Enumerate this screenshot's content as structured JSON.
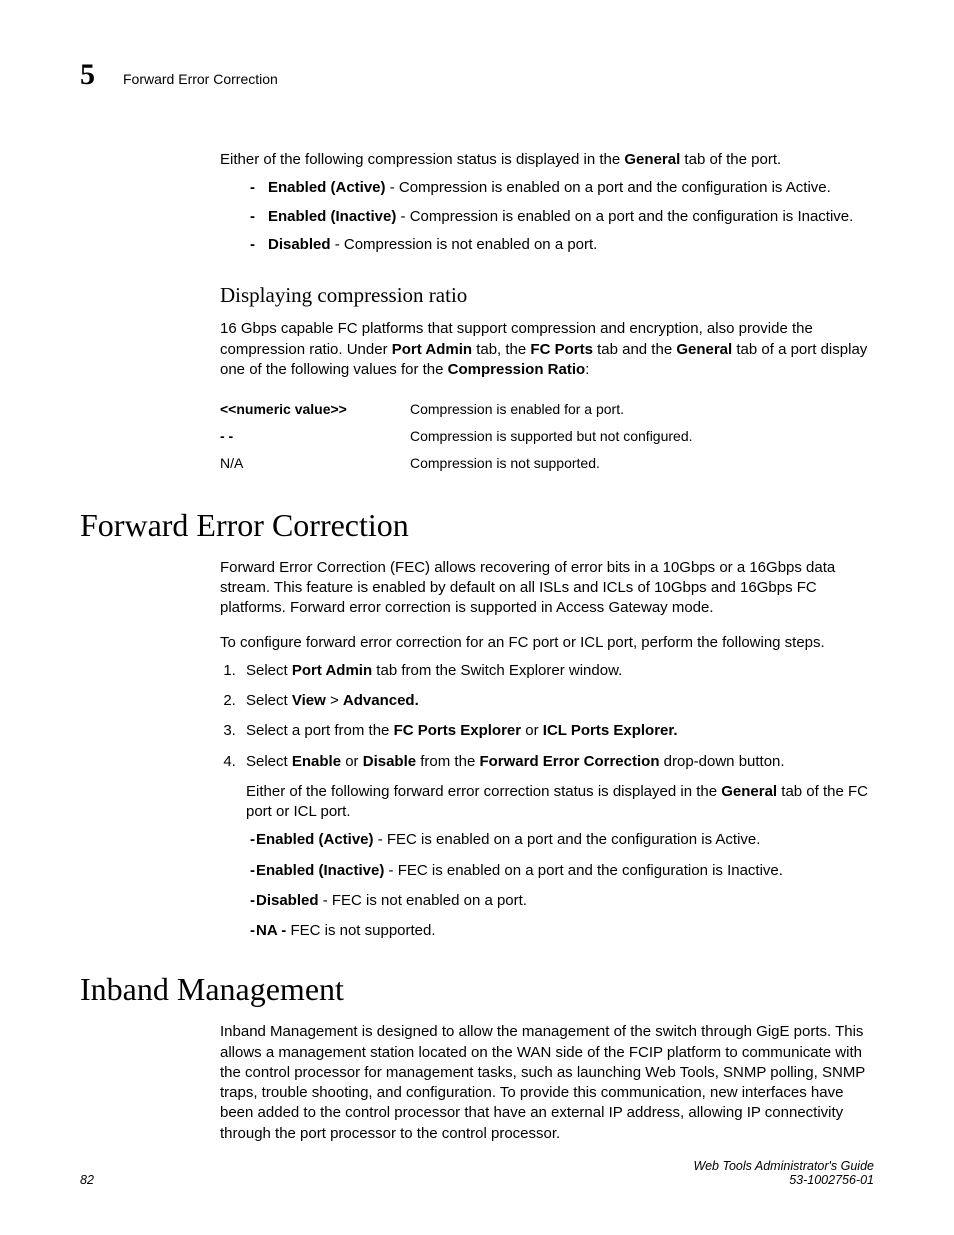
{
  "header": {
    "chapter_number": "5",
    "chapter_title": "Forward Error Correction"
  },
  "intro_para_a": "Either of the following compression status is displayed in the ",
  "intro_general": "General",
  "intro_para_b": " tab of the port.",
  "status_items": [
    {
      "label": "Enabled (Active)",
      "desc": " - Compression is enabled on a port and the configuration is Active."
    },
    {
      "label": "Enabled (Inactive)",
      "desc": " - Compression is enabled on a port and the configuration is Inactive."
    },
    {
      "label": "Disabled",
      "desc": " - Compression is not enabled on a port."
    }
  ],
  "sub_heading": "Displaying compression ratio",
  "ratio_para_a": "16 Gbps capable FC platforms that support compression and encryption, also provide the compression ratio. Under ",
  "ratio_b1": "Port Admin",
  "ratio_a2": " tab, the ",
  "ratio_b2": "FC Ports",
  "ratio_a3": " tab and the ",
  "ratio_b3": "General",
  "ratio_a4": " tab of a port display one of the following values for the ",
  "ratio_b4": "Compression Ratio",
  "ratio_a5": ":",
  "ratio_table": [
    {
      "key": "<<numeric value>>",
      "key_bold": true,
      "val": "Compression is enabled for a port."
    },
    {
      "key": "- -",
      "key_bold": true,
      "val": "Compression is supported but not configured."
    },
    {
      "key": "N/A",
      "key_bold": false,
      "val": "Compression is not supported."
    }
  ],
  "fec_heading": "Forward Error Correction",
  "fec_para": "Forward Error Correction (FEC) allows recovering of error bits in a 10Gbps or a 16Gbps data stream. This feature is enabled by default on all ISLs and ICLs of 10Gbps and 16Gbps FC platforms. Forward error correction is supported in Access Gateway mode.",
  "fec_config": "To configure forward error correction for an FC port or ICL port, perform the following steps.",
  "steps": {
    "s1a": "Select ",
    "s1b": "Port Admin",
    "s1c": " tab from the Switch Explorer window.",
    "s2a": "Select ",
    "s2b": "View",
    "s2c": " > ",
    "s2d": "Advanced.",
    "s3a": "Select a port from the ",
    "s3b": "FC Ports Explorer",
    "s3c": " or ",
    "s3d": "ICL Ports Explorer.",
    "s4a": "Select ",
    "s4b": "Enable",
    "s4c": " or ",
    "s4d": "Disable",
    "s4e": " from the ",
    "s4f": "Forward Error Correction",
    "s4g": " drop-down button.",
    "s4_follow_a": "Either of the following forward error correction status is displayed in the ",
    "s4_follow_b": "General",
    "s4_follow_c": " tab of the FC port or ICL port."
  },
  "fec_status": [
    {
      "label": "Enabled (Active)",
      "desc": " - FEC is enabled on a port and the configuration is Active."
    },
    {
      "label": "Enabled (Inactive)",
      "desc": " - FEC is enabled on a port and the configuration is Inactive."
    },
    {
      "label": "Disabled",
      "desc": " - FEC is not enabled on a port."
    },
    {
      "label": "NA - ",
      "desc": "FEC is not supported."
    }
  ],
  "inband_heading": "Inband Management",
  "inband_para": "Inband Management is designed to allow the management of the switch through GigE ports. This allows a management station located on the WAN side of the FCIP platform to communicate with the control processor for management tasks, such as launching Web Tools, SNMP polling, SNMP traps, trouble shooting, and configuration. To provide this communication, new interfaces have been added to the control processor that have an external IP address, allowing IP connectivity through the port processor to the control processor.",
  "footer": {
    "page": "82",
    "guide": "Web Tools Administrator's Guide",
    "docnum": "53-1002756-01"
  }
}
